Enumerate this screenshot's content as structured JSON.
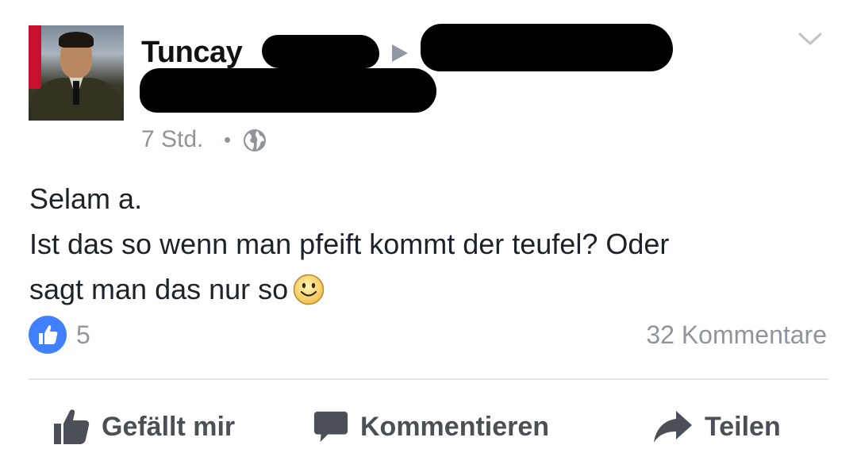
{
  "post": {
    "author_name": "Tuncay",
    "timestamp": "7 Std.",
    "separator": "•",
    "privacy_icon": "globe-icon",
    "text_lines": [
      "Selam a.",
      "Ist das so wenn man pfeift kommt der teufel? Oder",
      "sagt man das nur so"
    ],
    "emoji": "smiley-icon"
  },
  "reactions": {
    "like_count": "5",
    "comments_label": "32 Kommentare"
  },
  "actions": {
    "like_label": "Gefällt mir",
    "comment_label": "Kommentieren",
    "share_label": "Teilen"
  },
  "colors": {
    "accent_blue": "#4080ff",
    "meta_gray": "#90949c",
    "action_gray": "#4b4f56",
    "text": "#1d2129"
  }
}
